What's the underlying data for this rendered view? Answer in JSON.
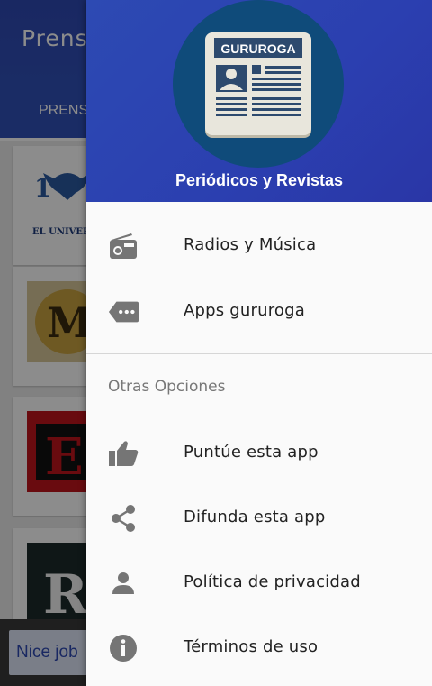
{
  "background": {
    "toolbar_title": "Prens",
    "tab_label": "PRENS",
    "card1_caption": "EL UNIVERS",
    "snackbar_button": "Nice job"
  },
  "drawer": {
    "header": {
      "logo_text": "GURUROGA",
      "app_name": "Periódicos y Revistas"
    },
    "items": [
      {
        "label": "Radios y Música",
        "icon": "radio-icon"
      },
      {
        "label": "Apps gururoga",
        "icon": "label-more-icon"
      }
    ],
    "section_title": "Otras Opciones",
    "other_items": [
      {
        "label": "Puntúe esta app",
        "icon": "thumb-up-icon"
      },
      {
        "label": "Difunda esta app",
        "icon": "share-icon"
      },
      {
        "label": "Política de privacidad",
        "icon": "person-icon"
      },
      {
        "label": "Términos de uso",
        "icon": "info-icon"
      }
    ]
  },
  "colors": {
    "header_blue": "#2b3fb0",
    "icon_gray": "#757575"
  }
}
